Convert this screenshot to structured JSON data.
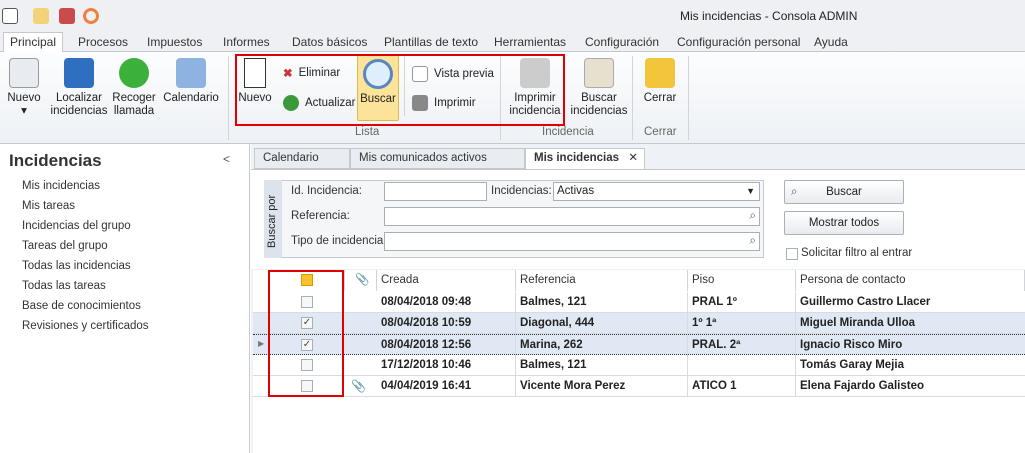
{
  "window": {
    "title": "Mis incidencias - Consola ADMIN"
  },
  "ribbon_tabs": [
    "Principal",
    "Procesos",
    "Impuestos",
    "Informes",
    "Datos básicos",
    "Plantillas de texto",
    "Herramientas",
    "Configuración",
    "Configuración personal",
    "Ayuda"
  ],
  "ribbon": {
    "nuevo_main": "Nuevo",
    "localizar": "Localizar incidencias",
    "recoger": "Recoger llamada",
    "calendario": "Calendario",
    "lista": {
      "nuevo": "Nuevo",
      "eliminar": "Eliminar",
      "actualizar": "Actualizar",
      "buscar": "Buscar",
      "vista_previa": "Vista previa",
      "imprimir": "Imprimir",
      "label": "Lista"
    },
    "incidencia": {
      "imprimir": "Imprimir incidencia",
      "buscar": "Buscar incidencias",
      "label": "Incidencia"
    },
    "cerrar": {
      "cerrar": "Cerrar",
      "label": "Cerrar"
    }
  },
  "sidebar": {
    "title": "Incidencias",
    "collapse": "<",
    "items": [
      "Mis incidencias",
      "Mis tareas",
      "Incidencias del grupo",
      "Tareas del grupo",
      "Todas las incidencias",
      "Todas las tareas",
      "Base de conocimientos",
      "Revisiones y certificados"
    ]
  },
  "doc_tabs": [
    "Calendario",
    "Mis comunicados activos",
    "Mis incidencias"
  ],
  "doc_close": "✕",
  "search": {
    "side_label": "Buscar por",
    "id_label": "Id. Incidencia:",
    "id_value": "",
    "incid_label": "Incidencias:",
    "incid_value": "Activas",
    "ref_label": "Referencia:",
    "ref_value": "",
    "tipo_label": "Tipo de incidencia:",
    "tipo_value": "",
    "buscar": "Buscar",
    "mostrar": "Mostrar todos",
    "solicitar": "Solicitar filtro al entrar"
  },
  "grid": {
    "columns": [
      "Creada",
      "Referencia",
      "Piso",
      "Persona de contacto"
    ],
    "rows": [
      {
        "checked": false,
        "clip": false,
        "creada": "08/04/2018 09:48",
        "ref": "Balmes, 121",
        "piso": "PRAL 1º",
        "persona": "Guillermo Castro Llacer"
      },
      {
        "checked": true,
        "clip": false,
        "creada": "08/04/2018 10:59",
        "ref": "Diagonal, 444",
        "piso": "1º 1ª",
        "persona": "Miguel Miranda Ulloa"
      },
      {
        "checked": true,
        "clip": false,
        "creada": "08/04/2018 12:56",
        "ref": "Marina, 262",
        "piso": "PRAL. 2ª",
        "persona": "Ignacio Risco Miro"
      },
      {
        "checked": false,
        "clip": false,
        "creada": "17/12/2018 10:46",
        "ref": "Balmes, 121",
        "piso": "",
        "persona": "Tomás Garay Mejia"
      },
      {
        "checked": false,
        "clip": true,
        "creada": "04/04/2019 16:41",
        "ref": "Vicente Mora Perez",
        "piso": "ATICO 1",
        "persona": "Elena Fajardo Galisteo"
      }
    ]
  }
}
